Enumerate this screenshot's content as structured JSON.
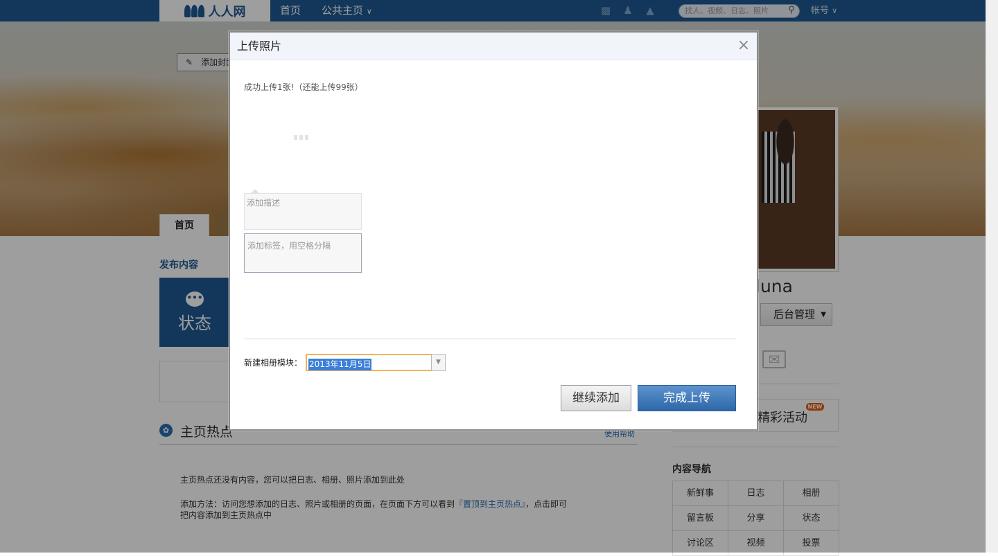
{
  "nav": {
    "logo": "人人网",
    "links": [
      "首页",
      "公共主页"
    ],
    "dropdown_caret": "⌄",
    "search_placeholder": "找人、视频、日志、照片",
    "account": "帐号"
  },
  "cover": {
    "add_cover_button": "添加封面",
    "tab_home": "首页"
  },
  "left": {
    "publish_title": "发布内容",
    "status_label": "状态",
    "hot_title": "主页热点",
    "hot_help": "使用帮助",
    "hot_empty": "主页热点还没有内容，您可以把日志、相册、照片添加到此处",
    "hot_method_prefix": "添加方法：访问您想添加的日志、照片或相册的页面，在页面下方可以看到",
    "hot_method_link": "『置顶到主页热点』",
    "hot_method_suffix": "，点击即可把内容添加到主页热点中"
  },
  "right": {
    "profile_name": "luna",
    "manage_button": "后台管理",
    "activity_label": "精彩活动",
    "new_badge": "NEW",
    "content_nav_title": "内容导航",
    "content_nav": [
      "新鲜事",
      "日志",
      "相册",
      "留言板",
      "分享",
      "状态",
      "讨论区",
      "视频",
      "投票"
    ]
  },
  "dialog": {
    "title": "上传照片",
    "close": "×",
    "success_text": "成功上传1张!（还能上传99张）",
    "desc_placeholder": "添加描述",
    "tag_placeholder": "添加标签，用空格分隔",
    "album_label": "新建相册模块：",
    "album_value": "2013年11月5日",
    "continue_button": "继续添加",
    "done_button": "完成上传"
  }
}
